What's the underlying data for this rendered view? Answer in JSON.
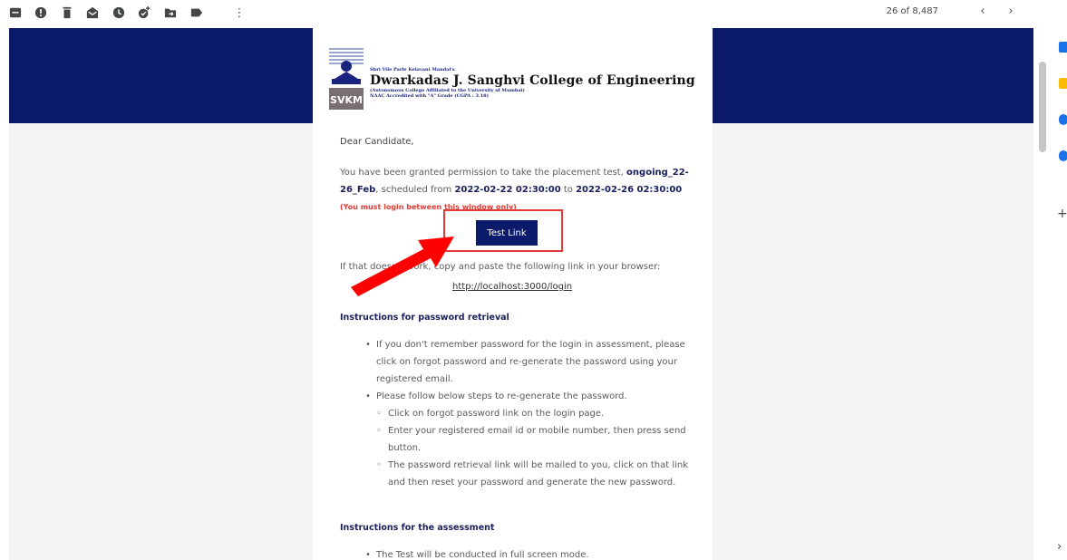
{
  "toolbar": {
    "icons": [
      "archive-icon",
      "report-spam-icon",
      "delete-icon",
      "mark-unread-icon",
      "snooze-icon",
      "add-task-icon",
      "move-to-icon",
      "label-icon",
      "more-icon"
    ],
    "pager": "26 of 8,487",
    "prev": "‹",
    "next": "›",
    "more": "⋮"
  },
  "header": {
    "mandal": "Shri Vile Parle Kelavani Mandal's",
    "college": "Dwarkadas J. Sanghvi College of Engineering",
    "affiliation": "(Autonomous College Affiliated to the University of Mumbai)",
    "naac": "NAAC Accredited with \"A\" Grade (CGPA : 3.18)",
    "logo_text": "SVKM"
  },
  "email": {
    "greeting": "Dear Candidate,",
    "intro": "You have been granted permission to take the placement test,",
    "test_name": "ongoing_22-26_Feb",
    "scheduled_from": ", scheduled from ",
    "start": "2022-02-22 02:30:00",
    "to": " to ",
    "end": "2022-02-26 02:30:00",
    "warning": "(You must login between this window only)",
    "button": "Test Link",
    "if_that": "If that doesn't work, copy and paste the following link in your browser:",
    "link": "http://localhost:3000/login",
    "instr_title": "Instructions for password retrieval",
    "instr": [
      "If you don't remember password for the login in assessment, please click on forgot password and re-generate the password using your registered email.",
      "Please follow below steps to re-generate the password."
    ],
    "sub_steps": [
      "Click on forgot password link on the login page.",
      "Enter your registered email id or mobile number, then press send button.",
      "The password retrieval link will be mailed to you, click on that link and then reset your password and generate the new password."
    ],
    "assess_title": "Instructions for the assessment",
    "assess": [
      "The Test will be conducted in full screen mode."
    ]
  },
  "colors": {
    "banner": "#0b1a6b",
    "button": "#0b1a6b",
    "highlight": "#e53935",
    "heading": "#1a1f5c"
  },
  "side": {
    "plus": "+",
    "expand": "›"
  }
}
